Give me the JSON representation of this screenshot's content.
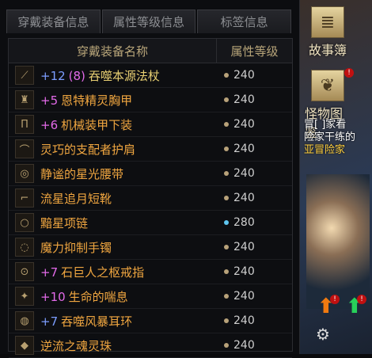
{
  "tabs": [
    {
      "label": "穿戴装备信息",
      "active": true
    },
    {
      "label": "属性等级信息",
      "active": false
    },
    {
      "label": "标签信息",
      "active": false
    }
  ],
  "table": {
    "header": {
      "name": "穿戴装备名称",
      "level": "属性等级"
    },
    "rows": [
      {
        "icon": "staff-icon",
        "plus": "+12",
        "extra": "(8)",
        "name": "吞噬本源法杖",
        "name_color": "yellow",
        "level": "240",
        "dot": "gold"
      },
      {
        "icon": "armor-icon",
        "plus": "+5",
        "extra": "",
        "name": "恩特精灵胸甲",
        "name_color": "orange",
        "level": "240",
        "dot": "gold"
      },
      {
        "icon": "legs-icon",
        "plus": "+6",
        "extra": "",
        "name": "机械装甲下装",
        "name_color": "orange",
        "level": "240",
        "dot": "gold"
      },
      {
        "icon": "shoulder-icon",
        "plus": "",
        "extra": "",
        "name": "灵巧的支配者护肩",
        "name_color": "orange",
        "level": "240",
        "dot": "gold"
      },
      {
        "icon": "belt-icon",
        "plus": "",
        "extra": "",
        "name": "静谧的星光腰带",
        "name_color": "orange",
        "level": "240",
        "dot": "gold"
      },
      {
        "icon": "boots-icon",
        "plus": "",
        "extra": "",
        "name": "流星追月短靴",
        "name_color": "orange",
        "level": "240",
        "dot": "gold"
      },
      {
        "icon": "necklace-icon",
        "plus": "",
        "extra": "",
        "name": "黯星项链",
        "name_color": "orange",
        "level": "280",
        "dot": "blue"
      },
      {
        "icon": "bracelet-icon",
        "plus": "",
        "extra": "",
        "name": "魔力抑制手镯",
        "name_color": "orange",
        "level": "240",
        "dot": "gold"
      },
      {
        "icon": "ring-icon",
        "plus": "+7",
        "extra": "",
        "name": "石巨人之枢戒指",
        "name_color": "orange",
        "level": "240",
        "dot": "gold"
      },
      {
        "icon": "gem-icon",
        "plus": "+10",
        "extra": "",
        "name": "生命的喘息",
        "name_color": "orange",
        "level": "240",
        "dot": "gold"
      },
      {
        "icon": "earring-icon",
        "plus": "+7",
        "extra": "",
        "name": "吞噬风暴耳环",
        "name_color": "orange",
        "level": "240",
        "dot": "gold"
      },
      {
        "icon": "pearl-icon",
        "plus": "",
        "extra": "",
        "name": "逆流之魂灵珠",
        "name_color": "orange",
        "level": "240",
        "dot": "gold"
      }
    ]
  },
  "side": {
    "storybook": {
      "label": "故事簿",
      "icon": "book-icon"
    },
    "bestiary": {
      "label": "怪物图鉴",
      "icon": "bestiary-icon",
      "badge": "!"
    },
    "story_lines": [
      "冒[ ]家看",
      "险家干练的",
      "亚冒险家"
    ],
    "colors": {
      "plus": "#e36ae9",
      "blue_plus": "#7c9dff",
      "orange": "#f0a640",
      "yellow": "#e8cf72"
    }
  }
}
